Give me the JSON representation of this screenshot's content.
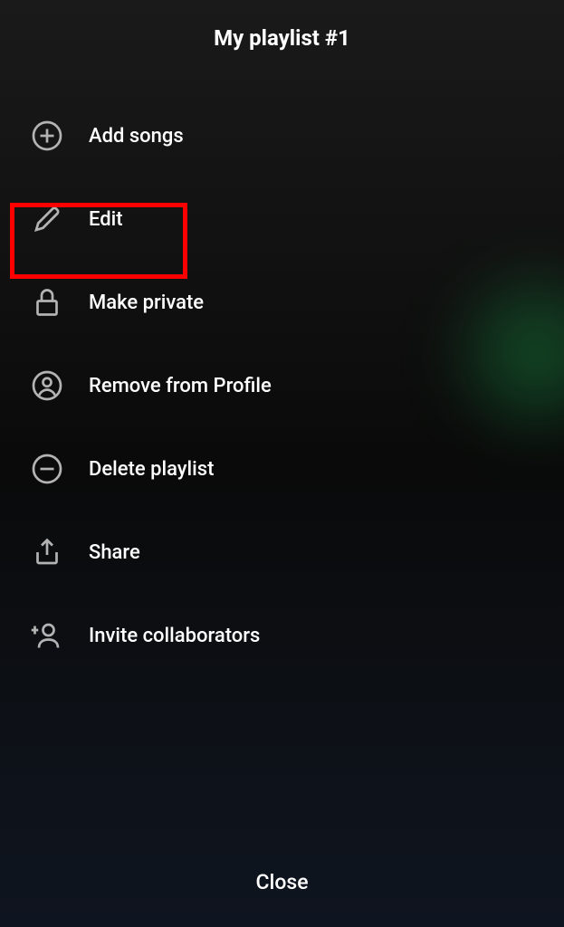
{
  "title": "My playlist #1",
  "menu": {
    "add_songs": "Add songs",
    "edit": "Edit",
    "make_private": "Make private",
    "remove_from_profile": "Remove from Profile",
    "delete_playlist": "Delete playlist",
    "share": "Share",
    "invite_collaborators": "Invite collaborators"
  },
  "close": "Close",
  "highlighted_item": "edit"
}
